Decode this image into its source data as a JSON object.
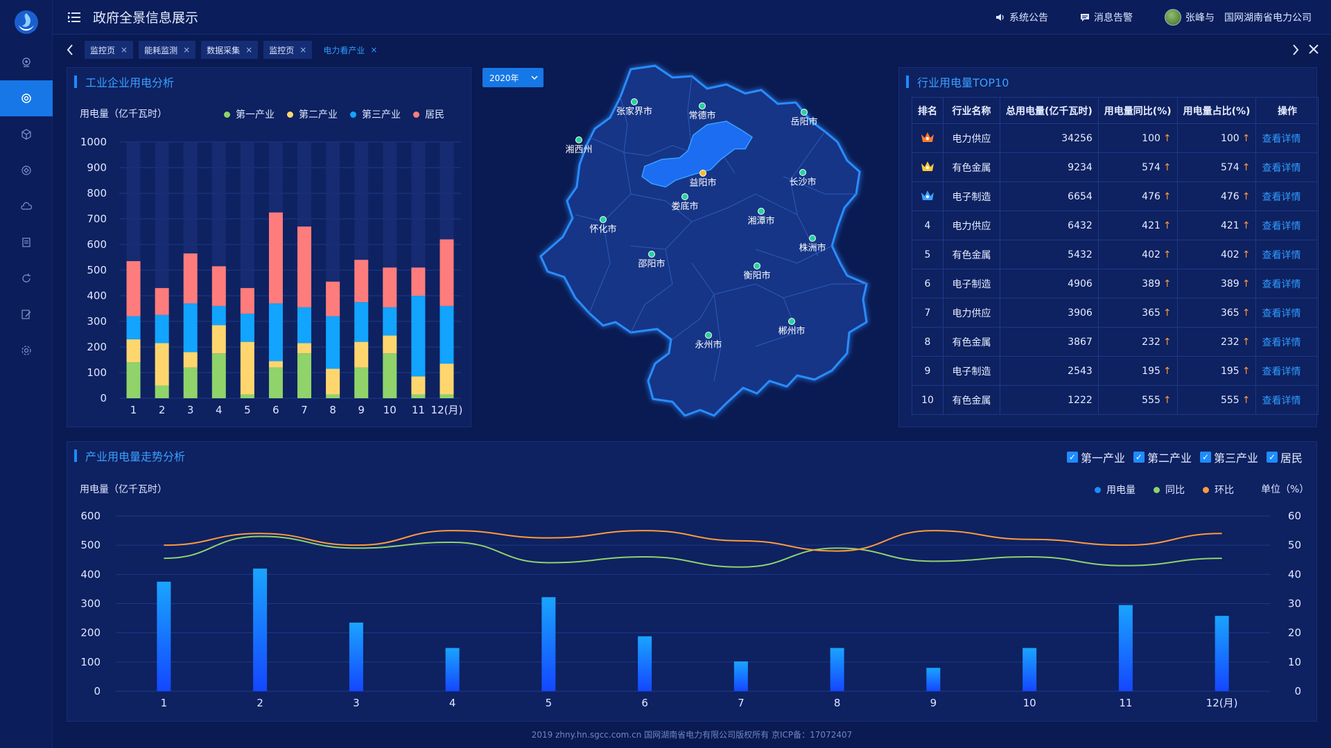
{
  "app": {
    "title": "政府全景信息展示",
    "announcement": "系统公告",
    "alert": "消息告警",
    "user": "张峰与",
    "company": "国网湖南省电力公司"
  },
  "sidebar": {
    "items": [
      {
        "icon": "location-icon"
      },
      {
        "icon": "target-icon",
        "active": true
      },
      {
        "icon": "cube-icon"
      },
      {
        "icon": "module-icon"
      },
      {
        "icon": "cloud-icon"
      },
      {
        "icon": "document-icon"
      },
      {
        "icon": "refresh-icon"
      },
      {
        "icon": "edit-icon"
      },
      {
        "icon": "settings-icon"
      }
    ]
  },
  "tabs": [
    {
      "label": "监控页",
      "active": false
    },
    {
      "label": "能耗监测",
      "active": false
    },
    {
      "label": "数据采集",
      "active": false
    },
    {
      "label": "监控页",
      "active": false
    },
    {
      "label": "电力看产业",
      "active": true
    }
  ],
  "industrial": {
    "title": "工业企业用电分析",
    "unit": "用电量（亿千瓦时）",
    "legend": [
      {
        "name": "第一产业",
        "color": "#8fd36a"
      },
      {
        "name": "第二产业",
        "color": "#ffd66e"
      },
      {
        "name": "第三产业",
        "color": "#12a4ff"
      },
      {
        "name": "居民",
        "color": "#ff7c7c"
      }
    ]
  },
  "year_select": {
    "value": "2020年"
  },
  "map": {
    "cities": [
      {
        "name": "张家界市"
      },
      {
        "name": "常德市"
      },
      {
        "name": "岳阳市"
      },
      {
        "name": "湘西州"
      },
      {
        "name": "益阳市"
      },
      {
        "name": "长沙市"
      },
      {
        "name": "娄底市"
      },
      {
        "name": "湘潭市"
      },
      {
        "name": "怀化市"
      },
      {
        "name": "邵阳市"
      },
      {
        "name": "株洲市"
      },
      {
        "name": "衡阳市"
      },
      {
        "name": "永州市"
      },
      {
        "name": "郴州市"
      }
    ]
  },
  "top10": {
    "title": "行业用电量TOP10",
    "headers": [
      "排名",
      "行业名称",
      "总用电量(亿千瓦时)",
      "用电量同比(%)",
      "用电量占比(%)",
      "操作"
    ],
    "rows": [
      {
        "rank": "1",
        "name": "电力供应",
        "total": "34256",
        "yoy": "100",
        "share": "100",
        "action": "查看详情"
      },
      {
        "rank": "2",
        "name": "有色金属",
        "total": "9234",
        "yoy": "574",
        "share": "574",
        "action": "查看详情"
      },
      {
        "rank": "3",
        "name": "电子制造",
        "total": "6654",
        "yoy": "476",
        "share": "476",
        "action": "查看详情"
      },
      {
        "rank": "4",
        "name": "电力供应",
        "total": "6432",
        "yoy": "421",
        "share": "421",
        "action": "查看详情"
      },
      {
        "rank": "5",
        "name": "有色金属",
        "total": "5432",
        "yoy": "402",
        "share": "402",
        "action": "查看详情"
      },
      {
        "rank": "6",
        "name": "电子制造",
        "total": "4906",
        "yoy": "389",
        "share": "389",
        "action": "查看详情"
      },
      {
        "rank": "7",
        "name": "电力供应",
        "total": "3906",
        "yoy": "365",
        "share": "365",
        "action": "查看详情"
      },
      {
        "rank": "8",
        "name": "有色金属",
        "total": "3867",
        "yoy": "232",
        "share": "232",
        "action": "查看详情"
      },
      {
        "rank": "9",
        "name": "电子制造",
        "total": "2543",
        "yoy": "195",
        "share": "195",
        "action": "查看详情"
      },
      {
        "rank": "10",
        "name": "有色金属",
        "total": "1222",
        "yoy": "555",
        "share": "555",
        "action": "查看详情"
      }
    ]
  },
  "trend": {
    "title": "产业用电量走势分析",
    "unit_left": "用电量（亿千瓦时）",
    "unit_right": "单位（%）",
    "checks": [
      "第一产业",
      "第二产业",
      "第三产业",
      "居民"
    ],
    "legend": [
      {
        "name": "用电量",
        "color": "#1e8cff"
      },
      {
        "name": "同比",
        "color": "#8fd36a"
      },
      {
        "name": "环比",
        "color": "#ff9b3a"
      }
    ]
  },
  "footer": "2019 zhny.hn.sgcc.com.cn 国网湖南省电力有限公司版权所有 京ICP备：17072407",
  "chart_data": [
    {
      "type": "bar",
      "stacked": true,
      "categories": [
        "1",
        "2",
        "3",
        "4",
        "5",
        "6",
        "7",
        "8",
        "9",
        "10",
        "11",
        "12(月)"
      ],
      "ylim": [
        0,
        1000
      ],
      "yticks": [
        0,
        100,
        200,
        300,
        400,
        500,
        600,
        700,
        800,
        900,
        1000
      ],
      "ylabel": "用电量（亿千瓦时）",
      "series": [
        {
          "name": "第一产业",
          "color": "#8fd36a",
          "values": [
            140,
            50,
            120,
            175,
            15,
            120,
            175,
            15,
            120,
            175,
            15,
            15
          ]
        },
        {
          "name": "第二产业",
          "color": "#ffd66e",
          "values": [
            90,
            165,
            60,
            110,
            205,
            25,
            40,
            100,
            100,
            70,
            70,
            120
          ]
        },
        {
          "name": "第三产业",
          "color": "#12a4ff",
          "values": [
            90,
            110,
            190,
            75,
            110,
            225,
            140,
            205,
            155,
            110,
            315,
            225
          ]
        },
        {
          "name": "居民",
          "color": "#ff7c7c",
          "values": [
            215,
            105,
            195,
            155,
            100,
            355,
            315,
            135,
            165,
            155,
            110,
            260
          ]
        }
      ]
    },
    {
      "type": "bar",
      "categories": [
        "1",
        "2",
        "3",
        "4",
        "5",
        "6",
        "7",
        "8",
        "9",
        "10",
        "11",
        "12(月)"
      ],
      "ylim": [
        0,
        600
      ],
      "yticks": [
        0,
        100,
        200,
        300,
        400,
        500,
        600
      ],
      "ylabel": "用电量（亿千瓦时）",
      "y2lim": [
        0,
        60
      ],
      "y2ticks": [
        0,
        10,
        20,
        30,
        40,
        50,
        60
      ],
      "y2label": "单位（%）",
      "series": [
        {
          "name": "用电量",
          "type": "bar",
          "values": [
            375,
            420,
            235,
            148,
            322,
            188,
            102,
            148,
            80,
            148,
            295,
            258
          ]
        },
        {
          "name": "同比",
          "type": "line",
          "axis": "right",
          "color": "#8fd36a",
          "values": [
            45.5,
            53,
            49,
            51,
            44,
            46,
            42.5,
            49,
            44.5,
            46,
            43,
            45.5
          ]
        },
        {
          "name": "环比",
          "type": "line",
          "axis": "right",
          "color": "#ff9b3a",
          "values": [
            50,
            54,
            50,
            55,
            52.5,
            55,
            51.5,
            48,
            55,
            52,
            50,
            54
          ]
        }
      ]
    }
  ]
}
